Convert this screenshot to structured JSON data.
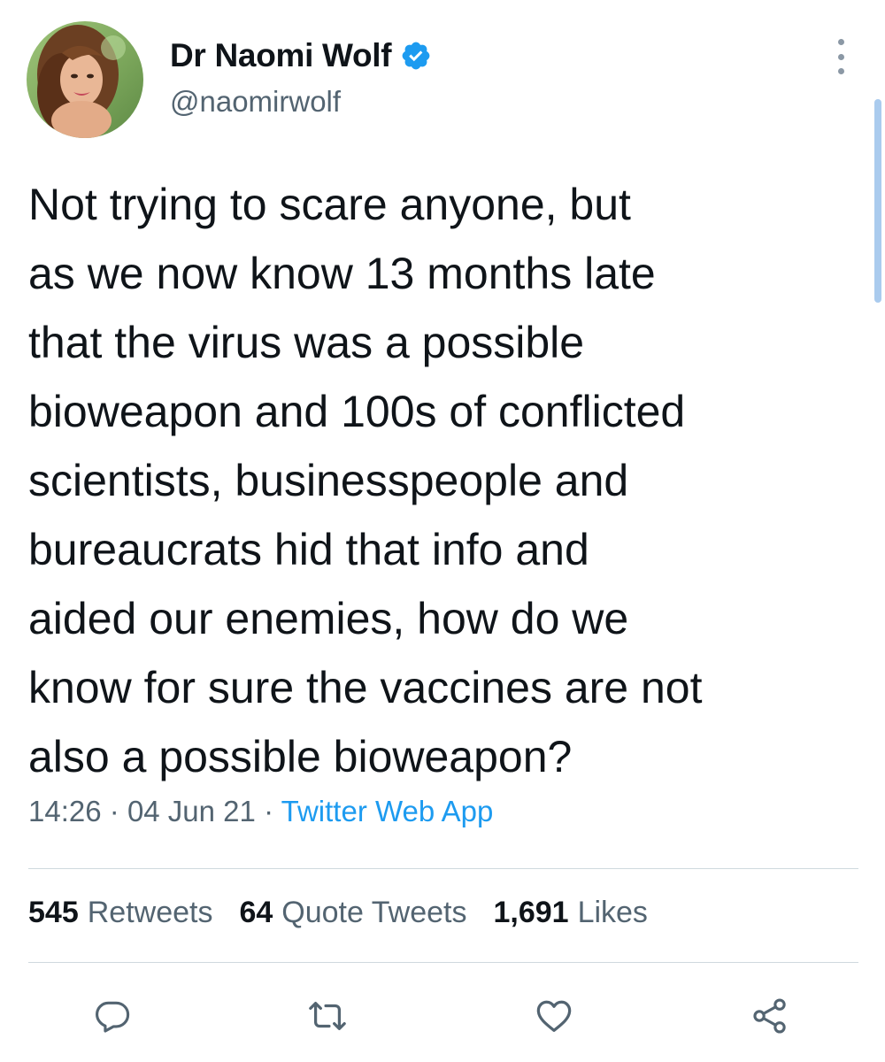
{
  "author": {
    "display_name": "Dr Naomi Wolf",
    "handle": "@naomirwolf",
    "verified": true,
    "verified_color": "#1d9bf0"
  },
  "tweet": {
    "text_lines": [
      "Not trying to scare anyone, but",
      "as we now know 13 months late",
      "that the virus was a possible",
      "bioweapon and 100s of conflicted",
      "scientists, businesspeople and",
      "bureaucrats hid that info and",
      "aided our enemies, how do we",
      "know for sure the vaccines are not",
      "also a possible bioweapon?"
    ],
    "time": "14:26",
    "date": "04 Jun 21",
    "separator": "·",
    "source": "Twitter Web App"
  },
  "stats": {
    "retweets_count": "545",
    "retweets_label": "Retweets",
    "quotes_count": "64",
    "quotes_label": "Quote Tweets",
    "likes_count": "1,691",
    "likes_label": "Likes"
  },
  "icons": {
    "more": "more-vertical-icon",
    "reply": "reply-icon",
    "retweet": "retweet-icon",
    "like": "heart-icon",
    "share": "share-icon",
    "verified": "verified-badge-icon"
  },
  "colors": {
    "text": "#0f1419",
    "secondary": "#536471",
    "link": "#1d9bf0",
    "divider": "#cfd9de",
    "scrollbar": "#aacbee"
  }
}
